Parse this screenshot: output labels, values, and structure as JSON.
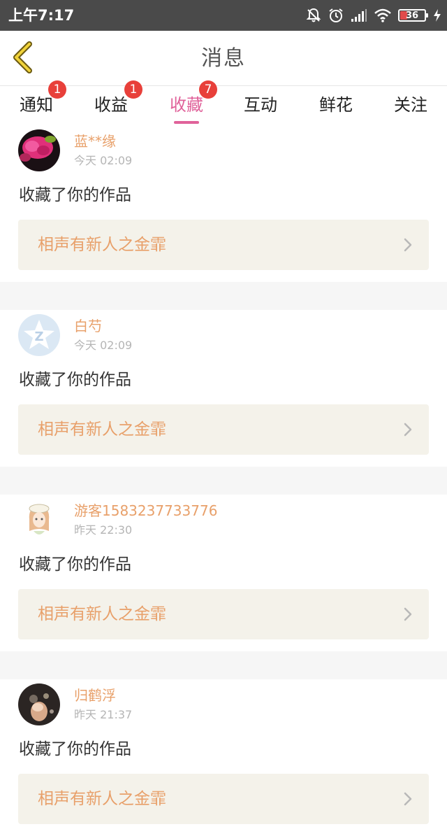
{
  "status_bar": {
    "time": "上午7:17",
    "battery": "36",
    "icons": [
      "bell-off-icon",
      "alarm-icon",
      "signal-icon",
      "wifi-icon",
      "battery-icon",
      "charging-icon"
    ]
  },
  "header": {
    "title": "消息",
    "back_icon": "chevron-left-icon"
  },
  "tabs": [
    {
      "label": "通知",
      "badge": "1",
      "active": false
    },
    {
      "label": "收益",
      "badge": "1",
      "active": false
    },
    {
      "label": "收藏",
      "badge": "7",
      "active": true
    },
    {
      "label": "互动",
      "badge": "",
      "active": false
    },
    {
      "label": "鲜花",
      "badge": "",
      "active": false
    },
    {
      "label": "关注",
      "badge": "",
      "active": false
    }
  ],
  "colors": {
    "accent": "#e0629a",
    "badge": "#e8403a",
    "username": "#e8a06a",
    "link_bg": "#f4f2ea"
  },
  "messages": [
    {
      "user": "蓝**缘",
      "time": "今天 02:09",
      "action": "收藏了你的作品",
      "work": "相声有新人之金霏"
    },
    {
      "user": "白芍",
      "time": "今天 02:09",
      "action": "收藏了你的作品",
      "work": "相声有新人之金霏"
    },
    {
      "user": "游客1583237733776",
      "time": "昨天 22:30",
      "action": "收藏了你的作品",
      "work": "相声有新人之金霏"
    },
    {
      "user": "归鹤浮",
      "time": "昨天 21:37",
      "action": "收藏了你的作品",
      "work": "相声有新人之金霏"
    }
  ]
}
